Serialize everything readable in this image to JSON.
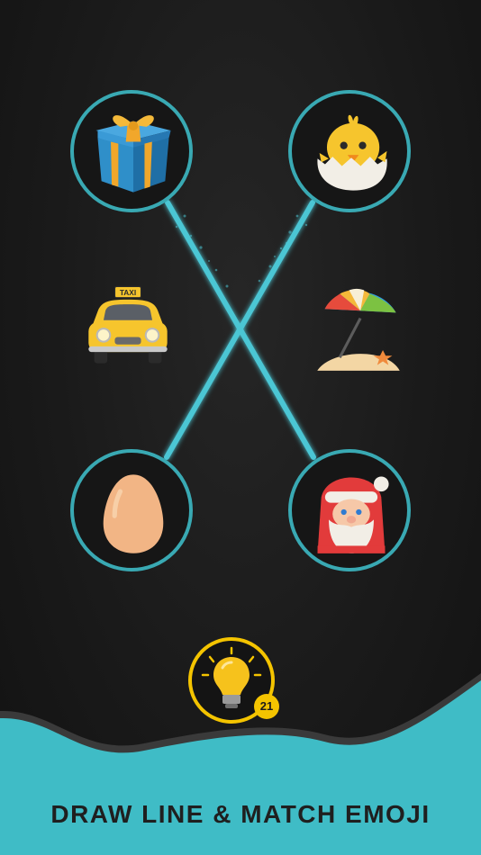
{
  "board": {
    "left_items": [
      {
        "name": "gift",
        "icon": "gift-icon"
      },
      {
        "name": "taxi",
        "icon": "taxi-icon"
      },
      {
        "name": "egg",
        "icon": "egg-icon"
      }
    ],
    "right_items": [
      {
        "name": "hatching-chick",
        "icon": "hatching-chick-icon"
      },
      {
        "name": "beach-umbrella",
        "icon": "beach-umbrella-icon"
      },
      {
        "name": "santa",
        "icon": "santa-icon"
      }
    ],
    "taxi_sign": "TAXI",
    "ring_color": "#39a9b3",
    "line_color": "#4cc6d4"
  },
  "hint": {
    "count": "21",
    "icon": "lightbulb-icon",
    "color": "#f4c400"
  },
  "footer": {
    "tagline": "DRAW LINE & MATCH EMOJI",
    "wave_color": "#3fbcc6"
  }
}
